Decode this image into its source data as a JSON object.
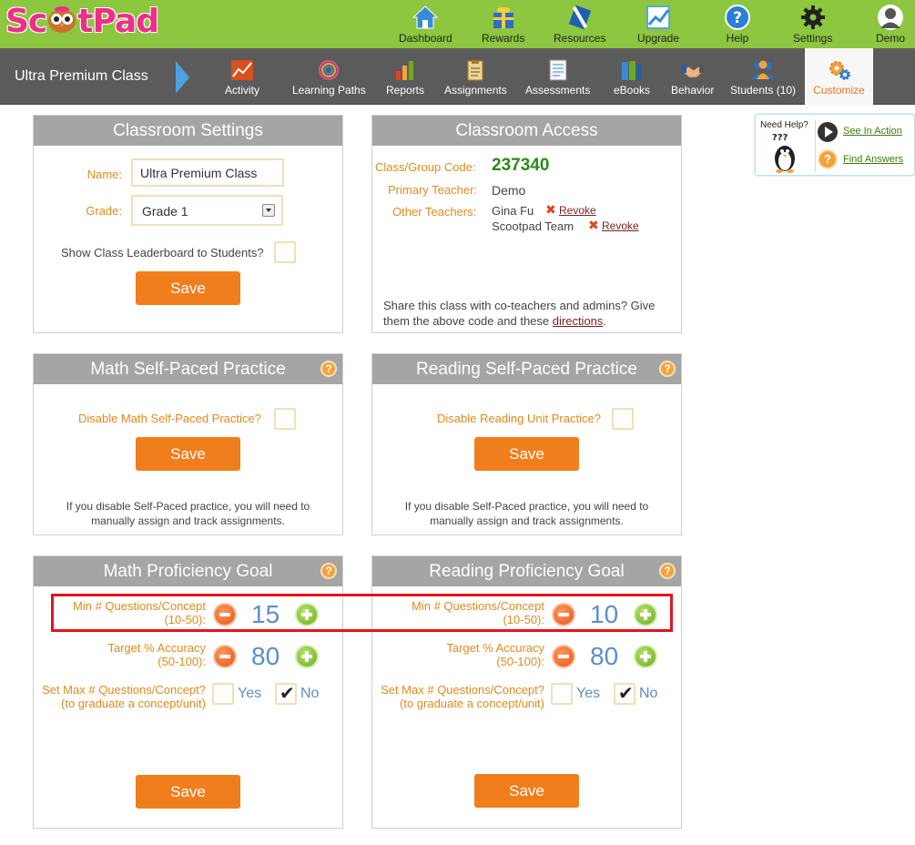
{
  "brand": {
    "logo_left": "Sc",
    "logo_right": "tPad",
    "colors": {
      "header_green": "#8dc63f",
      "accent_orange": "#f07e1c",
      "label_orange": "#e08a1e",
      "number_blue": "#5d8ec9",
      "highlight_red": "#e3141e"
    }
  },
  "topnav": [
    {
      "label": "Dashboard",
      "icon": "house-icon"
    },
    {
      "label": "Rewards",
      "icon": "gift-icon"
    },
    {
      "label": "Resources",
      "icon": "tools-icon"
    },
    {
      "label": "Upgrade",
      "icon": "chart-up-icon"
    },
    {
      "label": "Help",
      "icon": "question-icon"
    },
    {
      "label": "Settings",
      "icon": "gear-icon"
    },
    {
      "label": "Demo",
      "icon": "user-avatar-icon"
    }
  ],
  "subnav": {
    "class_name": "Ultra Premium Class",
    "items": [
      {
        "label": "Activity",
        "icon": "activity-chart-icon"
      },
      {
        "label": "Learning Paths",
        "icon": "spiral-icon"
      },
      {
        "label": "Reports",
        "icon": "bar-chart-icon"
      },
      {
        "label": "Assignments",
        "icon": "clipboard-icon"
      },
      {
        "label": "Assessments",
        "icon": "document-icon"
      },
      {
        "label": "eBooks",
        "icon": "books-icon"
      },
      {
        "label": "Behavior",
        "icon": "handshake-icon"
      },
      {
        "label": "Students (10)",
        "icon": "students-icon"
      },
      {
        "label": "Customize",
        "icon": "gears-icon",
        "active": true
      }
    ]
  },
  "help_widget": {
    "need_help": "Need Help?",
    "see_in_action": "See In Action",
    "find_answers": "Find Answers",
    "penguin_marks": "???"
  },
  "classroom_settings": {
    "title": "Classroom Settings",
    "name_label": "Name:",
    "name_value": "Ultra Premium Class",
    "grade_label": "Grade:",
    "grade_value": "Grade 1",
    "leaderboard_label": "Show Class Leaderboard to Students?",
    "save": "Save"
  },
  "classroom_access": {
    "title": "Classroom Access",
    "code_label": "Class/Group Code:",
    "code_value": "237340",
    "primary_label": "Primary Teacher:",
    "primary_value": "Demo",
    "other_label": "Other Teachers:",
    "teachers": [
      {
        "name": "Gina Fu",
        "action": "Revoke"
      },
      {
        "name": "Scootpad Team",
        "action": "Revoke"
      }
    ],
    "share_text": "Share this class with co-teachers and admins? Give them the above code and these",
    "share_link": "directions",
    "share_end": "."
  },
  "math_practice": {
    "title": "Math Self-Paced Practice",
    "disable_label": "Disable Math Self-Paced Practice?",
    "save": "Save",
    "note_line1": "If you disable Self-Paced practice, you will need to",
    "note_line2": "manually assign and track assignments."
  },
  "reading_practice": {
    "title": "Reading Self-Paced Practice",
    "disable_label": "Disable Reading Unit Practice?",
    "save": "Save",
    "note_line1": "If you disable Self-Paced practice, you will need to",
    "note_line2": "manually assign and track assignments."
  },
  "math_goal": {
    "title": "Math Proficiency Goal",
    "min_label_1": "Min # Questions/Concept",
    "min_label_2": "(10-50):",
    "min_value": "15",
    "acc_label_1": "Target % Accuracy",
    "acc_label_2": "(50-100):",
    "acc_value": "80",
    "max_label_1": "Set Max # Questions/Concept?",
    "max_label_2": "(to graduate a concept/unit)",
    "yes": "Yes",
    "no": "No",
    "no_checked": true,
    "save": "Save"
  },
  "reading_goal": {
    "title": "Reading Proficiency Goal",
    "min_label_1": "Min # Questions/Concept",
    "min_label_2": "(10-50):",
    "min_value": "10",
    "acc_label_1": "Target % Accuracy",
    "acc_label_2": "(50-100):",
    "acc_value": "80",
    "max_label_1": "Set Max # Questions/Concept?",
    "max_label_2": "(to graduate a concept/unit)",
    "yes": "Yes",
    "no": "No",
    "no_checked": true,
    "save": "Save"
  },
  "help_icon": "?"
}
